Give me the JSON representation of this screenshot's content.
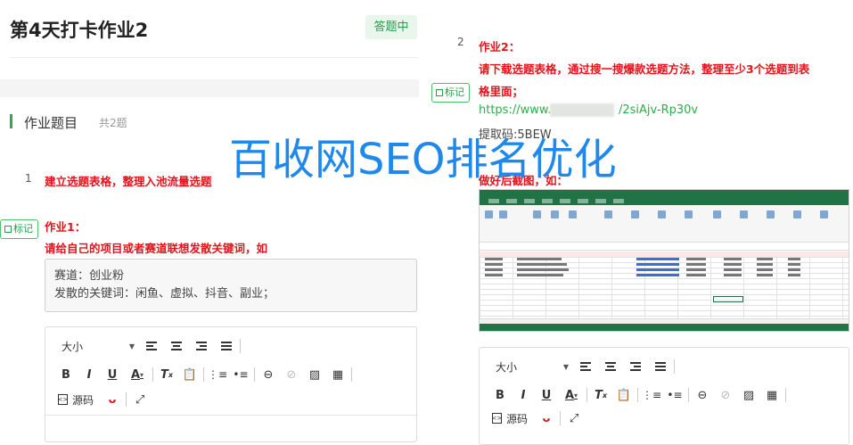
{
  "header": {
    "title": "第4天打卡作业2",
    "status": "答题中"
  },
  "section": {
    "title": "作业题目",
    "count": "共2题"
  },
  "question1": {
    "number": "1",
    "title": "建立选题表格，整理入池流量选题",
    "mark_label": "标记",
    "line1": "作业1：",
    "line2": "请给自己的项目或者赛道联想发散关键词，如",
    "answer_lines": [
      "赛道：创业粉",
      "发散的关键词：闲鱼、虚拟、抖音、副业；"
    ]
  },
  "question2": {
    "number": "2",
    "line1": "作业2：",
    "line2a": "请下载选题表格，通过搜一搜爆款选题方法，整理至少3个选题到表",
    "line2b": "格里面；",
    "mark_label": "标记",
    "link_prefix": "https://www.",
    "link_suffix": "/2siAjv-Rp30v",
    "code": "提取码:5BEW",
    "screenshot_caption": "做好后截图，如："
  },
  "editor": {
    "font_size_label": "大小",
    "source_label": "源码"
  },
  "watermark": "百收网SEO排名优化",
  "colors": {
    "accent": "#2aae4b",
    "instruction_red": "#e5121a",
    "watermark": "#1f88ea"
  }
}
